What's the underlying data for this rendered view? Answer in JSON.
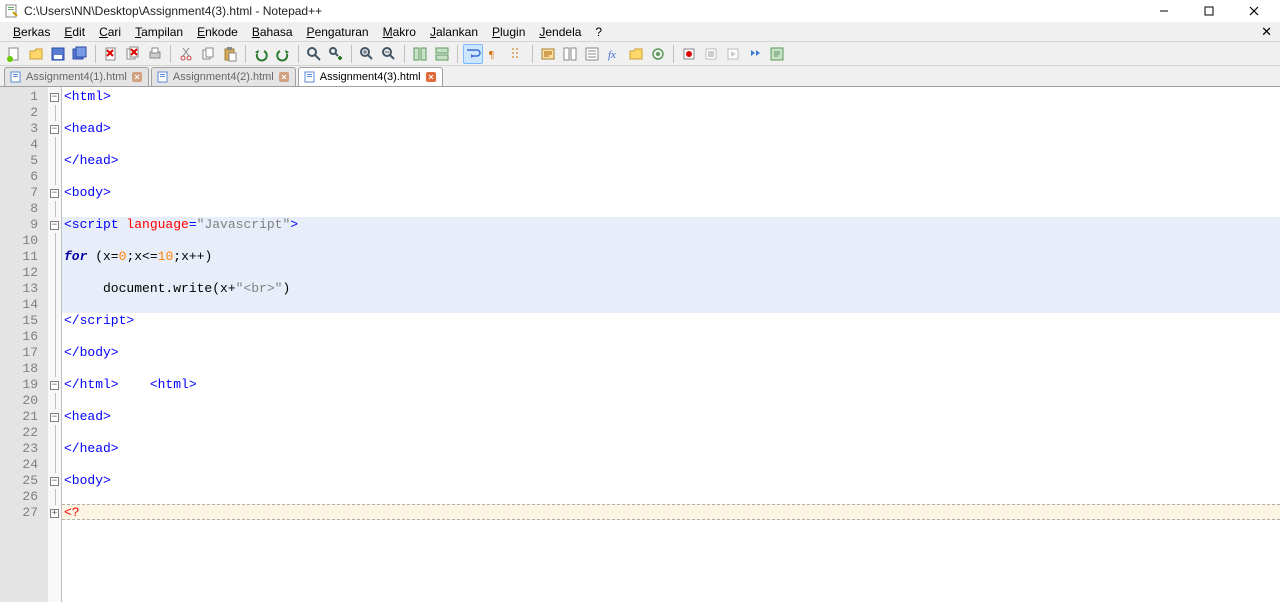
{
  "window": {
    "title": "C:\\Users\\NN\\Desktop\\Assignment4(3).html - Notepad++"
  },
  "menus": [
    {
      "label": "Berkas",
      "u": 0
    },
    {
      "label": "Edit",
      "u": 0
    },
    {
      "label": "Cari",
      "u": 0
    },
    {
      "label": "Tampilan",
      "u": 0
    },
    {
      "label": "Enkode",
      "u": 0
    },
    {
      "label": "Bahasa",
      "u": 0
    },
    {
      "label": "Pengaturan",
      "u": 0
    },
    {
      "label": "Makro",
      "u": 0
    },
    {
      "label": "Jalankan",
      "u": 0
    },
    {
      "label": "Plugin",
      "u": 0
    },
    {
      "label": "Jendela",
      "u": 0
    },
    {
      "label": "?",
      "u": -1
    }
  ],
  "tabs": [
    {
      "label": "Assignment4(1).html",
      "active": false
    },
    {
      "label": "Assignment4(2).html",
      "active": false
    },
    {
      "label": "Assignment4(3).html",
      "active": true
    }
  ],
  "lineCount": 27,
  "code": {
    "l1": {
      "pre": "",
      "t": [
        [
          "tag",
          "<html>"
        ]
      ]
    },
    "l2": {
      "pre": "",
      "t": []
    },
    "l3": {
      "pre": "",
      "t": [
        [
          "tag",
          "<head>"
        ]
      ]
    },
    "l4": {
      "pre": "",
      "t": []
    },
    "l5": {
      "pre": "",
      "t": [
        [
          "tag",
          "</head>"
        ]
      ]
    },
    "l6": {
      "pre": "",
      "t": []
    },
    "l7": {
      "pre": "",
      "t": [
        [
          "tag",
          "<body>"
        ]
      ]
    },
    "l8": {
      "pre": "",
      "t": []
    },
    "l9": {
      "pre": "",
      "t": [
        [
          "tag",
          "<script "
        ],
        [
          "attr",
          "language"
        ],
        [
          "tag",
          "="
        ],
        [
          "str",
          "\"Javascript\""
        ],
        [
          "tag",
          ">"
        ]
      ]
    },
    "l10": {
      "pre": "",
      "t": []
    },
    "l11": {
      "pre": "",
      "t": [
        [
          "kw",
          "for"
        ],
        [
          "",
          " (x="
        ],
        [
          "num",
          "0"
        ],
        [
          "",
          ";x<="
        ],
        [
          "num",
          "10"
        ],
        [
          "",
          ";x++)"
        ]
      ]
    },
    "l12": {
      "pre": "",
      "t": []
    },
    "l13": {
      "pre": "     ",
      "t": [
        [
          "",
          "document.write(x+"
        ],
        [
          "str",
          "\"<br>\""
        ],
        [
          "",
          ")"
        ]
      ]
    },
    "l14": {
      "pre": "",
      "t": []
    },
    "l15": {
      "pre": "",
      "t": [
        [
          "tag",
          "</script>"
        ]
      ]
    },
    "l16": {
      "pre": "",
      "t": []
    },
    "l17": {
      "pre": "",
      "t": [
        [
          "tag",
          "</body>"
        ]
      ]
    },
    "l18": {
      "pre": "",
      "t": []
    },
    "l19": {
      "pre": "",
      "t": [
        [
          "tag",
          "</html>"
        ],
        [
          "",
          "    "
        ],
        [
          "tag",
          "<html>"
        ]
      ]
    },
    "l20": {
      "pre": "",
      "t": []
    },
    "l21": {
      "pre": "",
      "t": [
        [
          "tag",
          "<head>"
        ]
      ]
    },
    "l22": {
      "pre": "",
      "t": []
    },
    "l23": {
      "pre": "",
      "t": [
        [
          "tag",
          "</head>"
        ]
      ]
    },
    "l24": {
      "pre": "",
      "t": []
    },
    "l25": {
      "pre": "",
      "t": [
        [
          "tag",
          "<body>"
        ]
      ]
    },
    "l26": {
      "pre": "",
      "t": []
    },
    "l27": {
      "pre": "",
      "t": [
        [
          "err",
          "<?"
        ]
      ]
    }
  },
  "fold": {
    "1": "minus",
    "3": "minus",
    "7": "minus",
    "9": "minus",
    "19": "minusR",
    "21": "minus",
    "25": "minus",
    "27": "plus"
  },
  "highlight": {
    "start": 9,
    "end": 14
  },
  "caretLine": 27,
  "colors": {
    "accent": "#cde6ff"
  }
}
